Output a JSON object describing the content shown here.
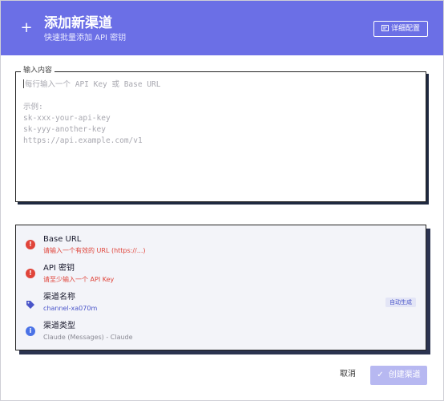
{
  "header": {
    "plus_glyph": "+",
    "title": "添加新渠道",
    "subtitle": "快速批量添加 API 密钥",
    "detail_button": "详细配置",
    "color": "#6b6fe6"
  },
  "input": {
    "legend": "输入内容",
    "placeholder_lines": [
      "每行输入一个 API Key 或 Base URL",
      "",
      "示例:",
      "sk-xxx-your-api-key",
      "sk-yyy-another-key",
      "https://api.example.com/v1"
    ]
  },
  "status": {
    "base_url": {
      "label": "Base URL",
      "message": "请输入一个有效的 URL (https://...)",
      "icon": "error-icon"
    },
    "api_key": {
      "label": "API 密钥",
      "message": "请至少输入一个 API Key",
      "icon": "error-icon"
    },
    "channel_name": {
      "label": "渠道名称",
      "value": "channel-xa070m",
      "badge": "自动生成",
      "icon": "tag-icon"
    },
    "channel_type": {
      "label": "渠道类型",
      "value": "Claude (Messages) - Claude",
      "icon": "info-icon"
    }
  },
  "footer": {
    "cancel": "取消",
    "create": "创建渠道"
  },
  "colors": {
    "error": "#e0443a",
    "info": "#4a72e6",
    "accent": "#4a55c9",
    "create_disabled": "#b7b8f1"
  }
}
